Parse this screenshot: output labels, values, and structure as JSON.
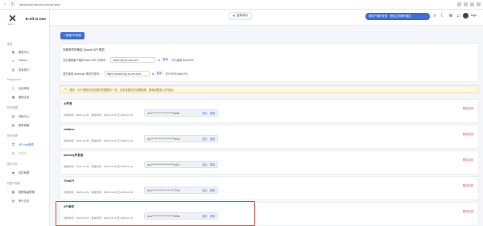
{
  "browser": {
    "url": "dashboard.aiecone.com/ai-keys"
  },
  "brand": {
    "name": "E-All in One",
    "sub": "E-ALL"
  },
  "sidebar": {
    "groups": [
      {
        "label": "概览",
        "items": [
          {
            "label": "模型中心"
          },
          {
            "label": "Tokens"
          },
          {
            "label": "用量统计"
          }
        ]
      },
      {
        "label": "Playground",
        "items": [
          {
            "label": "对话体验"
          },
          {
            "label": "图像生成"
          }
        ]
      },
      {
        "label": "财务管理",
        "items": [
          {
            "label": "充值中心"
          },
          {
            "label": "账单明细"
          }
        ]
      },
      {
        "label": "账号管理",
        "items": [
          {
            "label": "API Key管理"
          },
          {
            "label": "子账号"
          }
        ]
      },
      {
        "label": "团队协作",
        "items": [
          {
            "label": "成员管理"
          }
        ]
      },
      {
        "label": "数据与隐私",
        "items": [
          {
            "label": "数据保留策略"
          },
          {
            "label": "审计日志"
          }
        ]
      }
    ]
  },
  "topbar": {
    "toast": "复制成功",
    "promo": "新用户限时优惠 · 充值立享额外赠送",
    "user_name": "tugo"
  },
  "main": {
    "add_button": "+ 新建API密钥",
    "section_title": "本服务同时兼容 OpenAI API 规范",
    "endpoints": [
      {
        "label": "请在通用客户端的 Base URL 中填写：",
        "url": "https://api.ai-one.com",
        "hint": "作为通用 BaseURL"
      },
      {
        "label": "或在使用 Anthropic 格式时填写：",
        "url": "https://claude.api.ai-one.com",
        "hint": "作为专用 BaseURL"
      }
    ],
    "alert": "提示：API 密钥仅在创建时完整展示一次，请妥善保存并定期轮换，避免泄露至公开仓库。",
    "copy_label": "复制",
    "show_label": "显示",
    "delete_label": "删除密钥",
    "keys": [
      {
        "name": "AI开发",
        "dates": "创建时间：2025-12-05　有效时间：2025-12-05 至 2099-12-31",
        "masked": "sk-f**********************5a3b"
      },
      {
        "name": "chatbox",
        "dates": "创建时间：2025-12-06　有效时间：2025-12-06 至 2099-12-31",
        "masked": "sk-7**********************9c0d"
      },
      {
        "name": "boomby开发测",
        "dates": "创建时间：2025-12-08　有效时间：2025-12-08 至 2099-12-31",
        "masked": "sk-2**********************e41f"
      },
      {
        "name": "TestAPI",
        "dates": "创建时间：2025-12-09　有效时间：2025-12-09 至 2099-12-31",
        "masked": "sk-b**********************77a2"
      },
      {
        "name": "API测试",
        "dates": "创建时间：2025-12-10　有效时间：2025-12-10 至 2099-12-31",
        "masked": "sk-a**********************d08e"
      }
    ]
  },
  "colors": {
    "accent": "#3b6ddc",
    "danger": "#e05a5a",
    "highlight": "#e04848"
  }
}
